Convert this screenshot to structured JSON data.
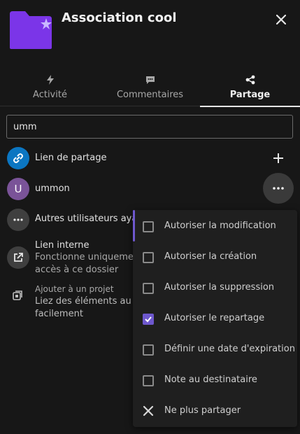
{
  "header": {
    "title": "Association cool",
    "folder_color": "#7b35e8"
  },
  "tabs": [
    {
      "label": "Activité",
      "icon": "activity-icon"
    },
    {
      "label": "Commentaires",
      "icon": "comment-icon"
    },
    {
      "label": "Partage",
      "icon": "share-icon",
      "active": true
    }
  ],
  "search": {
    "value": "umm"
  },
  "rows": {
    "share_link": {
      "label": "Lien de partage",
      "icon": "link-icon",
      "color": "#0b76c2"
    },
    "user": {
      "initial": "U",
      "name": "ummon",
      "color": "#7a5398"
    },
    "others": {
      "label": "Autres utilisateurs ayant accès"
    },
    "internal": {
      "title": "Lien interne",
      "line1": "Fonctionne uniquement pour les utilisateurs ayant",
      "line2": "accès à ce dossier"
    },
    "project": {
      "title": "Ajouter à un projet",
      "line1": "Liez des éléments au projet pour les retrouver plus",
      "line2": "facilement"
    }
  },
  "menu": {
    "accent": "#6e58ce",
    "items": [
      {
        "label": "Autoriser la modification",
        "checked": false
      },
      {
        "label": "Autoriser la création",
        "checked": false
      },
      {
        "label": "Autoriser la suppression",
        "checked": false
      },
      {
        "label": "Autoriser le repartage",
        "checked": true
      },
      {
        "label": "Définir une date d'expiration",
        "checked": false
      },
      {
        "label": "Note au destinataire",
        "checked": false
      }
    ],
    "unshare": "Ne plus partager"
  }
}
